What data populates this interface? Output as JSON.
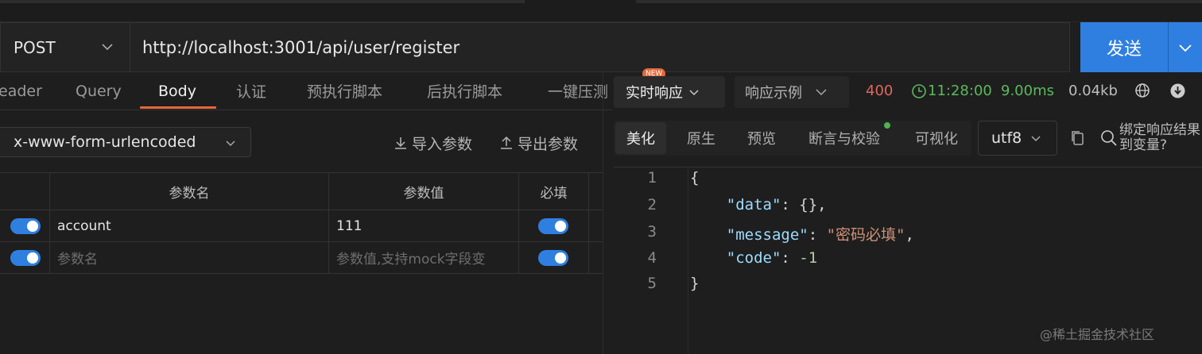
{
  "request": {
    "method": "POST",
    "url": "http://localhost:3001/api/user/register",
    "send_label": "发送"
  },
  "left_tabs": [
    "eader",
    "Query",
    "Body",
    "认证",
    "预执行脚本",
    "后执行脚本",
    "一键压测"
  ],
  "active_tab": "Body",
  "new_badge": "NEW",
  "body": {
    "encoding": "x-www-form-urlencoded",
    "import_label": "导入参数",
    "export_label": "导出参数",
    "columns": [
      "参数名",
      "参数值",
      "必填"
    ],
    "rows": [
      {
        "name": "account",
        "value": "111",
        "enabled": true,
        "required": true
      },
      {
        "name": "参数名",
        "value": "参数值,支持mock字段变",
        "enabled": true,
        "required": true,
        "placeholder": true
      }
    ]
  },
  "response": {
    "view_selector": "实时响应",
    "example_selector": "响应示例",
    "status": "400",
    "time": "11:28:00",
    "duration": "9.00ms",
    "size": "0.04kb",
    "tabs": [
      "美化",
      "原生",
      "预览",
      "断言与校验",
      "可视化"
    ],
    "active_tab": "美化",
    "charset": "utf8",
    "bind_label": "绑定响应结果到变量?",
    "code_lines": [
      {
        "n": "1",
        "text": "{"
      },
      {
        "n": "2",
        "key": "\"data\"",
        "rest": ": {},"
      },
      {
        "n": "3",
        "key": "\"message\"",
        "str": "\"密码必填\"",
        "rest": ","
      },
      {
        "n": "4",
        "key": "\"code\"",
        "num": "-1"
      },
      {
        "n": "5",
        "text": "}"
      }
    ]
  },
  "watermark": "@稀土掘金技术社区",
  "colors": {
    "accent": "#2f7fe0",
    "tab_underline": "#e5673b",
    "status_error": "#e0675b",
    "success": "#5cb85c"
  }
}
